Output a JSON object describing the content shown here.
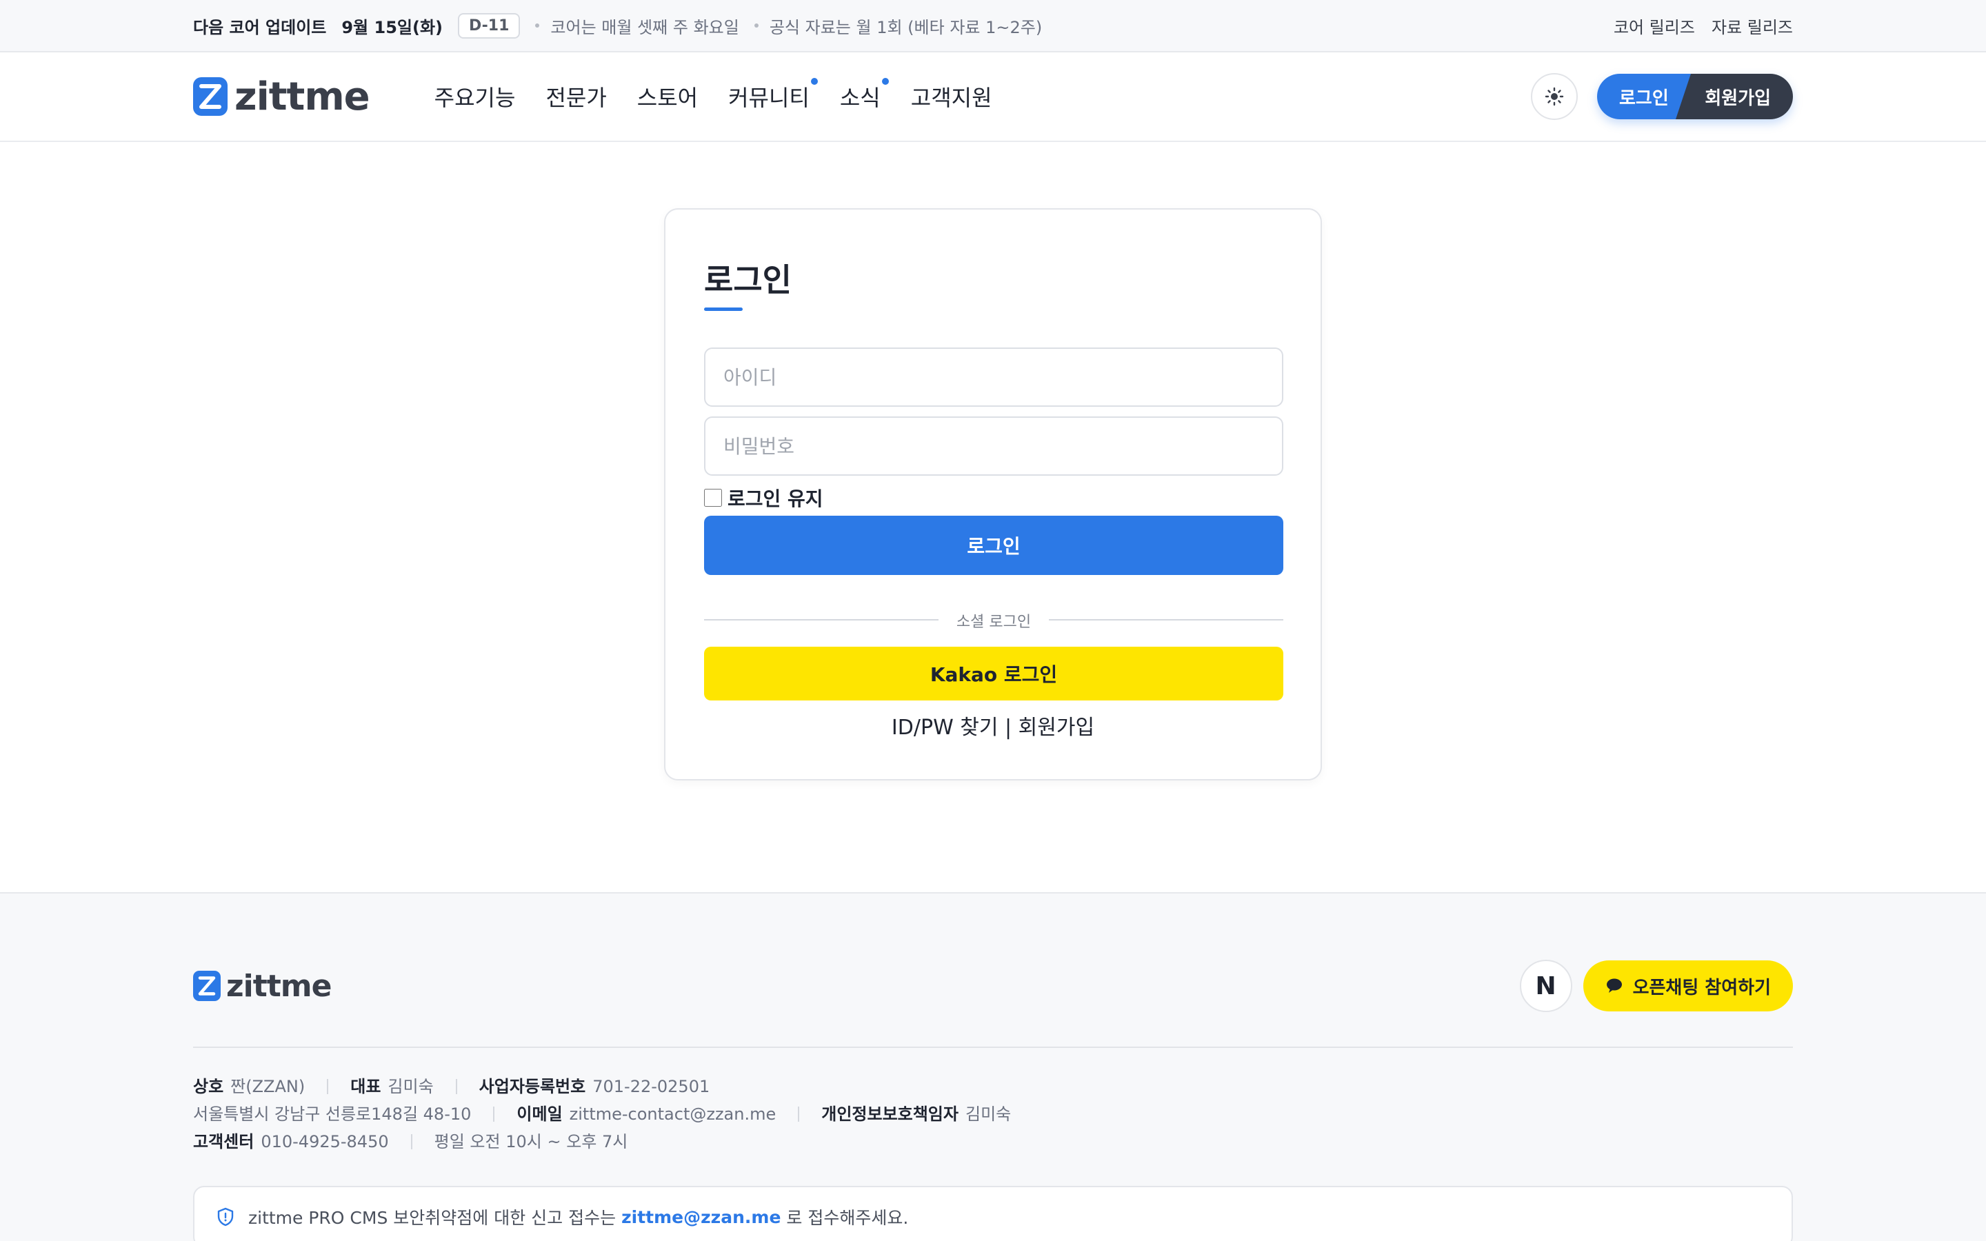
{
  "topbar": {
    "label": "다음 코어 업데이트",
    "date": "9월 15일(화)",
    "dday": "D-11",
    "note1": "코어는 매월 셋째 주 화요일",
    "note2": "공식 자료는 월 1회 (베타 자료 1~2주)",
    "link_core": "코어 릴리즈",
    "link_resource": "자료 릴리즈"
  },
  "header": {
    "logo_text": "zittme",
    "nav": [
      "주요기능",
      "전문가",
      "스토어",
      "커뮤니티",
      "소식",
      "고객지원"
    ],
    "login_label": "로그인",
    "signup_label": "회원가입",
    "theme_icon": "sun-icon"
  },
  "login": {
    "title": "로그인",
    "id_placeholder": "아이디",
    "pw_placeholder": "비밀번호",
    "remember_label": "로그인 유지",
    "submit_label": "로그인",
    "social_label": "소셜 로그인",
    "kakao_label": "Kakao 로그인",
    "links_text": "ID/PW 찾기 | 회원가입"
  },
  "footer": {
    "logo_text": "zittme",
    "naver_label": "N",
    "openchat_label": "오픈채팅 참여하기",
    "company_key": "상호",
    "company_val": "짠(ZZAN)",
    "ceo_key": "대표",
    "ceo_val": "김미숙",
    "biz_key": "사업자등록번호",
    "biz_val": "701-22-02501",
    "address": "서울특별시 강남구 선릉로148길 48-10",
    "email_key": "이메일",
    "email_val": "zittme-contact@zzan.me",
    "privacy_key": "개인정보보호책임자",
    "privacy_val": "김미숙",
    "cs_key": "고객센터",
    "cs_val": "010-4925-8450",
    "hours": "평일 오전 10시 ~ 오후 7시",
    "notice_pre": "zittme PRO CMS 보안취약점에 대한 신고 접수는",
    "notice_mail": "zittme@zzan.me",
    "notice_post": "로 접수해주세요."
  },
  "colors": {
    "accent": "#2c79e6",
    "kakao": "#fee500",
    "dark": "#343b49"
  }
}
